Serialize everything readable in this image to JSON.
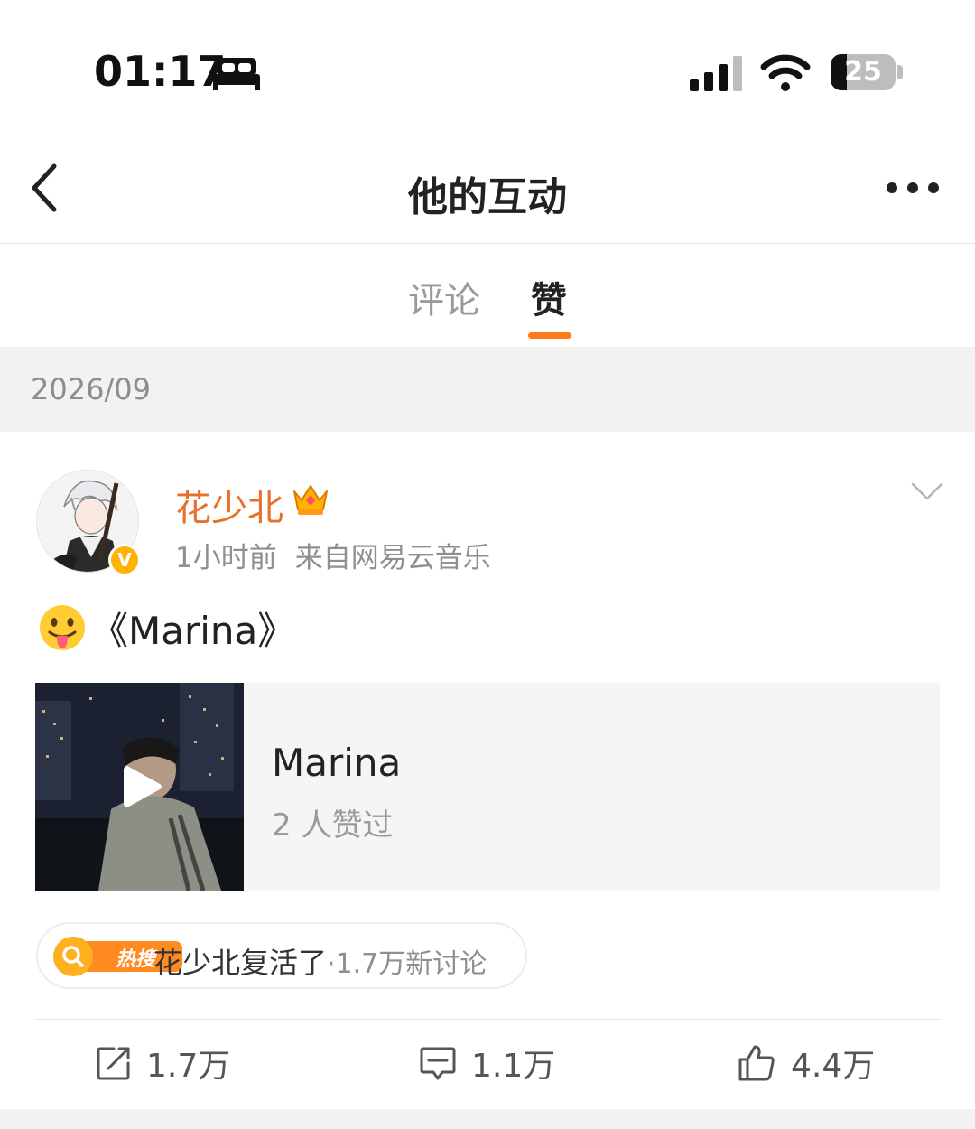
{
  "status_bar": {
    "time": "01:17",
    "battery": "25",
    "battery_level": 0.25,
    "icons": [
      "sleep-focus-icon",
      "cellular-signal-icon",
      "wifi-icon",
      "battery-icon"
    ]
  },
  "nav": {
    "title": "他的互动",
    "back_icon": "chevron-left-icon",
    "more_icon": "more-dots-icon"
  },
  "tabs": [
    {
      "label": "评论",
      "active": false
    },
    {
      "label": "赞",
      "active": true
    }
  ],
  "accent_color": "#ff7a1a",
  "date_header": "2026/09",
  "post": {
    "author": "花少北",
    "author_color": "#e8702a",
    "badge_icon": "crown-icon",
    "verified": "V",
    "time": "1小时前",
    "source": "来自网易云音乐",
    "text": "《Marina》",
    "emoji_icon": "tongue-out-emoji-icon",
    "music": {
      "title": "Marina",
      "likes": "2 人赞过"
    },
    "hot_search": {
      "badge": "热搜",
      "topic": "花少北复活了",
      "count": "·1.7万新讨论"
    },
    "actions": {
      "repost": "1.7万",
      "comment": "1.1万",
      "like": "4.4万"
    }
  }
}
